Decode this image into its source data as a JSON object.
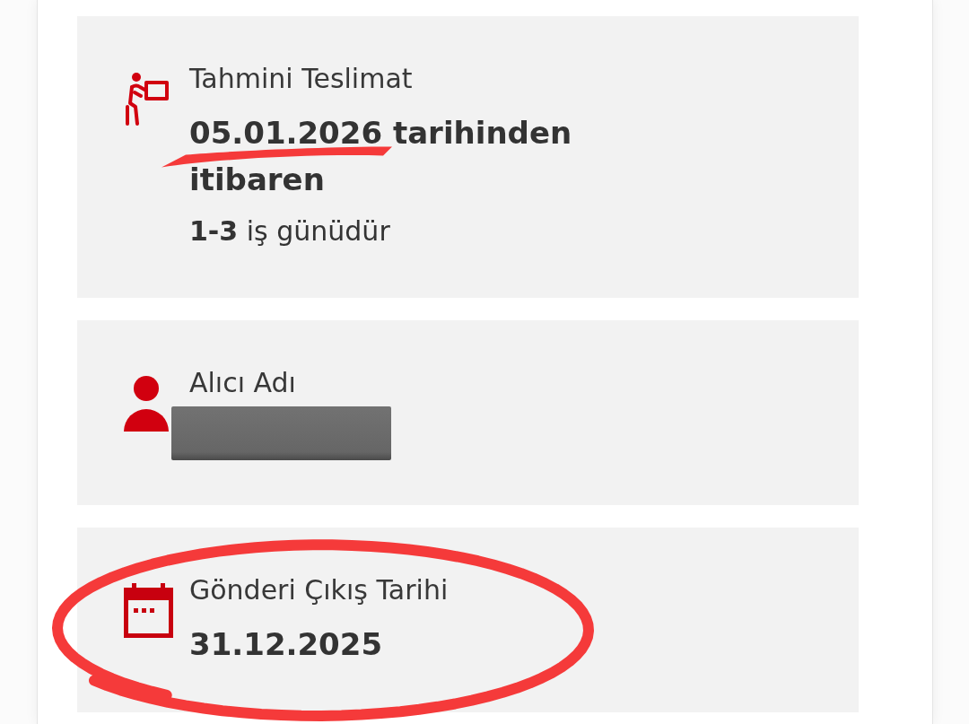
{
  "cards": [
    {
      "kind": "estimate",
      "label": "Tahmini Teslimat",
      "value": "05.01.2026 tarihinden itibaren",
      "note": "**1-3** iş günüdür",
      "redacted": false,
      "underlined": true,
      "circled": false
    },
    {
      "kind": "recipient",
      "label": "Alıcı Adı",
      "redacted": true,
      "underlined": false,
      "circled": false
    },
    {
      "kind": "dispatch",
      "label": "Gönderi Çıkış Tarihi",
      "value": "31.12.2025",
      "redacted": false,
      "underlined": false,
      "circled": true
    }
  ]
}
